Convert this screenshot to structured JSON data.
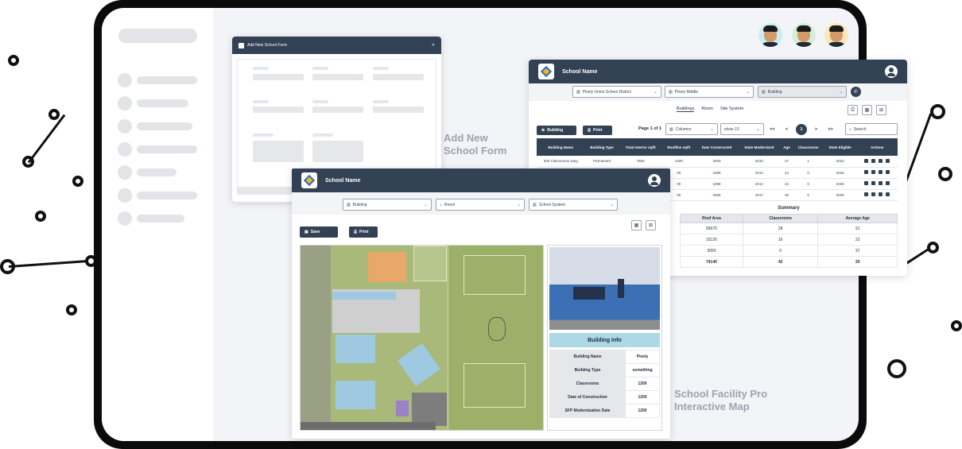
{
  "captions": {
    "form": "Add New School Form",
    "map": "School Facility Pro Interactive Map"
  },
  "form_window": {
    "title": "Add New School Form"
  },
  "table_window": {
    "title": "School Name",
    "filters": [
      "Pixely Union School District",
      "Pixely Middle",
      "Building"
    ],
    "tabs": [
      "Buildings",
      "Room",
      "Site System"
    ],
    "building_label": "Building",
    "print_label": "Print",
    "pagination": {
      "page_text": "Page 1 of 1",
      "columns": "Columns",
      "show": "show 10",
      "first": "<<",
      "prev": "<",
      "current": "1",
      "next": ">",
      "last": ">>",
      "search": "Search"
    },
    "columns": [
      "Building Name",
      "Building Type",
      "Total Interior sq/ft",
      "Roofline sq/ft",
      "Date Constructed",
      "State Modernized",
      "Age",
      "Classrooms",
      "State Eligible",
      "Actions"
    ],
    "rows": [
      [
        "300 Classrooms wing",
        "Permanent",
        "7500",
        "1200",
        "2000",
        "2010",
        "27",
        "1",
        "2023"
      ],
      [
        "",
        "",
        "",
        "00",
        "1998",
        "2012",
        "24",
        "0",
        "2025"
      ],
      [
        "",
        "",
        "",
        "00",
        "1998",
        "2012",
        "24",
        "0",
        "2025"
      ],
      [
        "",
        "",
        "",
        "00",
        "2006",
        "2017",
        "30",
        "0",
        "2030"
      ]
    ],
    "summary": {
      "title": "Summary",
      "columns": [
        "Roof Area",
        "Classrooms",
        "Average Age"
      ],
      "rows": [
        [
          "55670",
          "28",
          "31"
        ],
        [
          "15120",
          "16",
          "22"
        ],
        [
          "3050",
          "0",
          "37"
        ],
        [
          "74140",
          "42",
          "30"
        ]
      ]
    }
  },
  "map_window": {
    "title": "School Name",
    "filters": [
      "Building",
      "Room",
      "School System"
    ],
    "save_label": "Save",
    "print_label": "Print",
    "info": {
      "title": "Building Info",
      "rows": [
        [
          "Building Name",
          "Pixely"
        ],
        [
          "Building Type",
          "something"
        ],
        [
          "Classrooms",
          "1200"
        ],
        [
          "Date of Construction",
          "1200"
        ],
        [
          "SFP Modernization Date",
          "1200"
        ]
      ]
    }
  },
  "colors": {
    "header": "#334155",
    "accent": "#add8e6",
    "map_grass": "#a8b97a"
  }
}
